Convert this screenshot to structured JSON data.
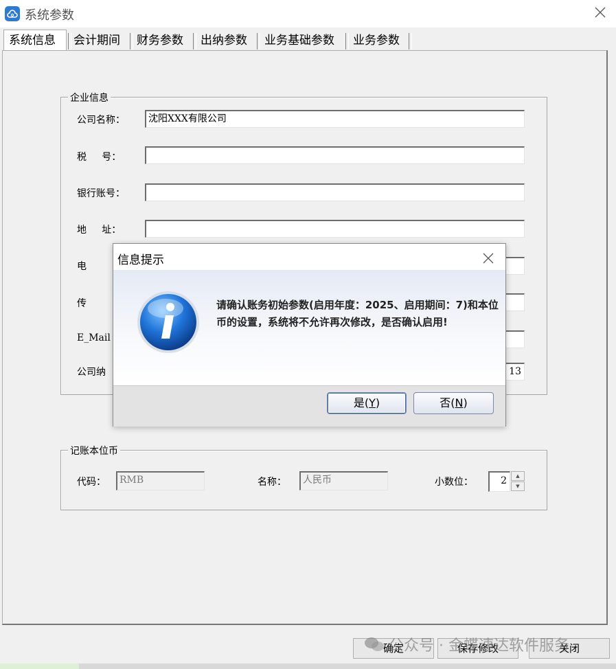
{
  "window": {
    "title": "系统参数",
    "close_glyph": "╳"
  },
  "tabs": [
    {
      "label": "系统信息"
    },
    {
      "label": "会计期间"
    },
    {
      "label": "财务参数"
    },
    {
      "label": "出纳参数"
    },
    {
      "label": "业务基础参数"
    },
    {
      "label": "业务参数"
    }
  ],
  "company": {
    "legend": "企业信息",
    "name_label": "公司名称：",
    "name_value": "沈阳XXX有限公司",
    "tax_label": "税     号：",
    "tax_value": "",
    "bank_label": "银行账号：",
    "bank_value": "",
    "addr_label": "地     址：",
    "addr_value": "",
    "phone_label": "电",
    "fax_label": "传",
    "email_label": "E_Mail",
    "taxrate_label": "公司纳",
    "taxrate_value": "13"
  },
  "currency": {
    "legend": "记账本位币",
    "code_label": "代码：",
    "code_value": "RMB",
    "name_label": "名称：",
    "name_value": "人民币",
    "decimals_label": "小数位：",
    "decimals_value": "2"
  },
  "bottom_buttons": {
    "ok": "确定",
    "save": "保存修改",
    "close": "关闭"
  },
  "dialog": {
    "title": "信息提示",
    "message": "请确认账务初始参数(启用年度：2025、启用期间：7)和本位币的设置，系统将不允许再次修改，是否确认启用!",
    "yes_label": "是(",
    "yes_key": "Y",
    "yes_end": ")",
    "no_label": "否(",
    "no_key": "N",
    "no_end": ")"
  },
  "watermark": "公众号 · 金蝶速达软件服务",
  "colors": {
    "app_icon": "#2a7ad6",
    "info_icon": "#1f73d8"
  }
}
